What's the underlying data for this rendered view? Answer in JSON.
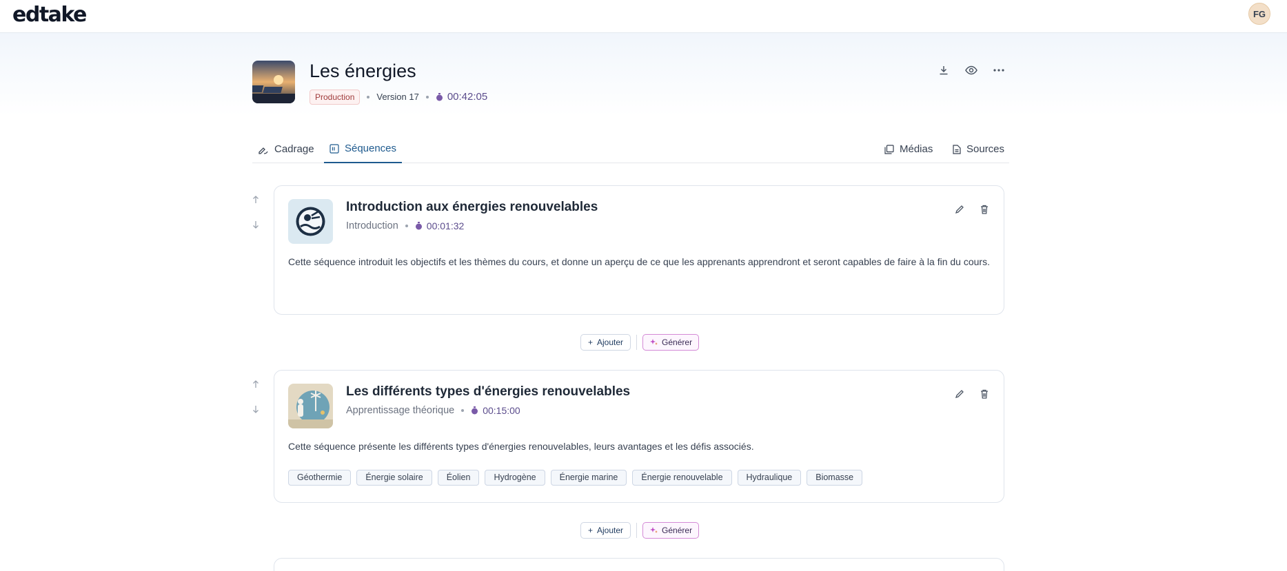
{
  "app": {
    "logo_text": "edtake",
    "user_initials": "FG"
  },
  "course": {
    "title": "Les énergies",
    "status_badge": "Production",
    "version": "Version 17",
    "duration": "00:42:05",
    "actions": [
      "download-icon",
      "eye-icon",
      "more-icon"
    ]
  },
  "tabs": {
    "cadrage": "Cadrage",
    "sequences": "Séquences",
    "medias": "Médias",
    "sources": "Sources",
    "active": "Séquences"
  },
  "sequences": [
    {
      "title": "Introduction aux énergies renouvelables",
      "type": "Introduction",
      "duration": "00:01:32",
      "description": "Cette séquence introduit les objectifs et les thèmes du cours, et donne un aperçu de ce que les apprenants apprendront et seront capables de faire à la fin du cours.",
      "tags": []
    },
    {
      "title": "Les différents types d'énergies renouvelables",
      "type": "Apprentissage théorique",
      "duration": "00:15:00",
      "description": "Cette séquence présente les différents types d'énergies renouvelables, leurs avantages et les défis associés.",
      "tags": [
        "Géothermie",
        "Énergie solaire",
        "Éolien",
        "Hydrogène",
        "Énergie marine",
        "Énergie renouvelable",
        "Hydraulique",
        "Biomasse"
      ]
    }
  ],
  "insert_actions": {
    "add_label": "Ajouter",
    "generate_label": "Générer"
  },
  "colors": {
    "accent": "#1e5a8e",
    "timer": "#7a5aa8",
    "badge_text": "#a03b3b",
    "generate_border": "#d48ad6"
  }
}
